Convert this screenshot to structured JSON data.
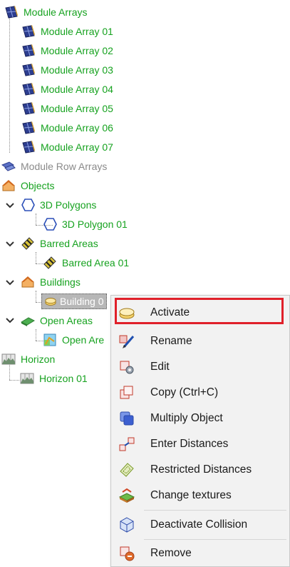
{
  "tree": {
    "module_arrays": {
      "label": "Module Arrays",
      "children": [
        "Module Array 01",
        "Module Array 02",
        "Module Array 03",
        "Module Array 04",
        "Module Array 05",
        "Module Array 06",
        "Module Array 07"
      ]
    },
    "module_row_arrays": {
      "label": "Module Row Arrays"
    },
    "objects": {
      "label": "Objects"
    },
    "polygons": {
      "label": "3D Polygons",
      "child": "3D Polygon 01"
    },
    "barred": {
      "label": "Barred Areas",
      "child": "Barred Area 01"
    },
    "buildings": {
      "label": "Buildings",
      "child": "Building 0"
    },
    "open_areas": {
      "label": "Open Areas",
      "child": "Open Are"
    },
    "horizon": {
      "label": "Horizon",
      "child": "Horizon 01"
    }
  },
  "context_menu": {
    "items": [
      {
        "label": "Activate",
        "icon": "building-activate-icon"
      },
      {
        "label": "Rename",
        "icon": "rename-icon"
      },
      {
        "label": "Edit",
        "icon": "edit-icon"
      },
      {
        "label": "Copy (Ctrl+C)",
        "icon": "copy-icon"
      },
      {
        "label": "Multiply Object",
        "icon": "multiply-icon"
      },
      {
        "label": "Enter Distances",
        "icon": "distances-icon"
      },
      {
        "label": "Restricted Distances",
        "icon": "restricted-distances-icon"
      },
      {
        "label": "Change textures",
        "icon": "textures-icon"
      },
      {
        "label": "Deactivate Collision",
        "icon": "collision-icon"
      },
      {
        "label": "Remove",
        "icon": "remove-icon"
      }
    ]
  },
  "colors": {
    "tree_text": "#16a21f",
    "disabled_text": "#8a8a8a",
    "highlight_border": "#e0202a",
    "menu_bg": "#f2f2f2"
  }
}
